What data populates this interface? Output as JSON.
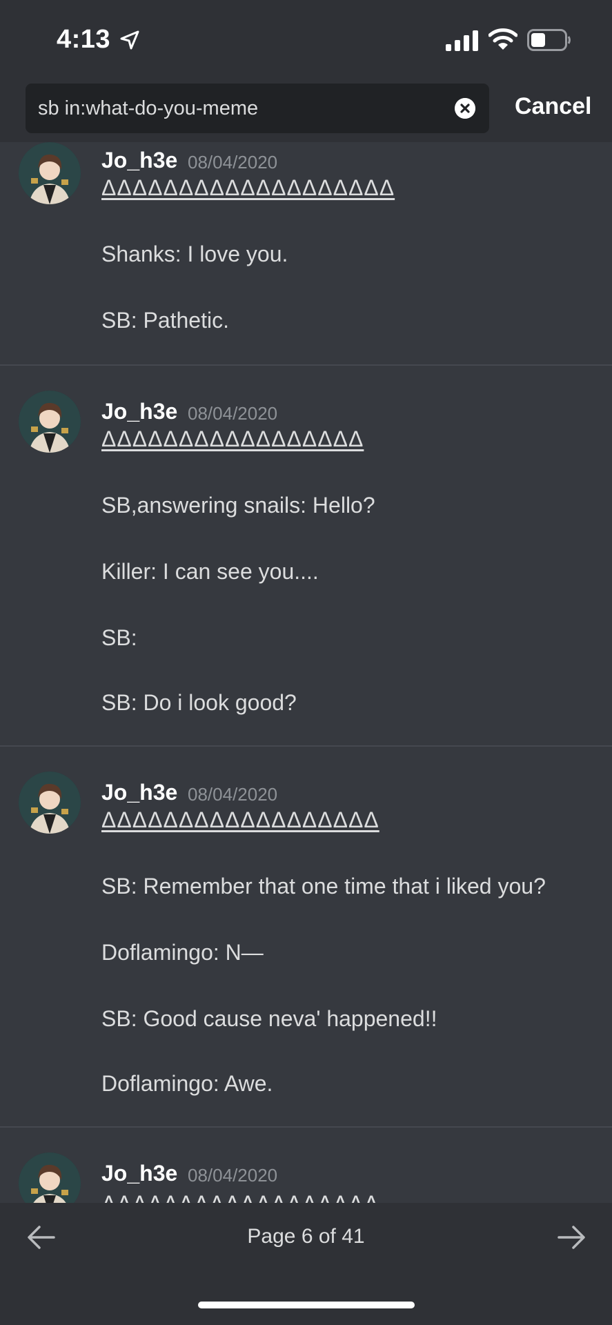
{
  "status_bar": {
    "time": "4:13"
  },
  "search": {
    "query": "sb in:what-do-you-meme",
    "cancel_label": "Cancel"
  },
  "results": [
    {
      "author": "Jo_h3e",
      "date": "08/04/2020",
      "lines": [
        {
          "text": "ΔΔΔΔΔΔΔΔΔΔΔΔΔΔΔΔΔΔΔ",
          "underline": true
        },
        {
          "text": "Shanks: I love you."
        },
        {
          "text": "SB: Pathetic."
        }
      ]
    },
    {
      "author": "Jo_h3e",
      "date": "08/04/2020",
      "lines": [
        {
          "text": "ΔΔΔΔΔΔΔΔΔΔΔΔΔΔΔΔΔ",
          "underline": true
        },
        {
          "text": "SB,answering snails: Hello?"
        },
        {
          "text": "Killer: I can see you...."
        },
        {
          "text": "SB:"
        },
        {
          "text": "SB: Do i look good?"
        }
      ]
    },
    {
      "author": "Jo_h3e",
      "date": "08/04/2020",
      "lines": [
        {
          "text": "ΔΔΔΔΔΔΔΔΔΔΔΔΔΔΔΔΔΔ",
          "underline": true
        },
        {
          "text": "SB: Remember that one time that i liked you?"
        },
        {
          "text": "Doflamingo: N—"
        },
        {
          "text": "SB: Good cause neva' happened!!"
        },
        {
          "text": "Doflamingo: Awe."
        }
      ]
    },
    {
      "author": "Jo_h3e",
      "date": "08/04/2020",
      "lines": [
        {
          "text": "ΔΔΔΔΔΔΔΔΔΔΔΔΔΔΔΔΔΔ",
          "underline": true
        }
      ]
    }
  ],
  "pagination": {
    "label": "Page 6 of 41",
    "current": 6,
    "total": 41
  },
  "icons": {
    "location": "location-arrow-icon",
    "signal": "cellular-signal-icon",
    "wifi": "wifi-icon",
    "battery": "battery-icon",
    "clear": "clear-search-icon",
    "prev": "arrow-left-icon",
    "next": "arrow-right-icon"
  },
  "colors": {
    "background": "#36393f",
    "header": "#2f3136",
    "search_field": "#202225",
    "text_primary": "#ffffff",
    "text_secondary": "#dcddde",
    "text_muted": "#8e9297",
    "divider": "#45484f"
  }
}
